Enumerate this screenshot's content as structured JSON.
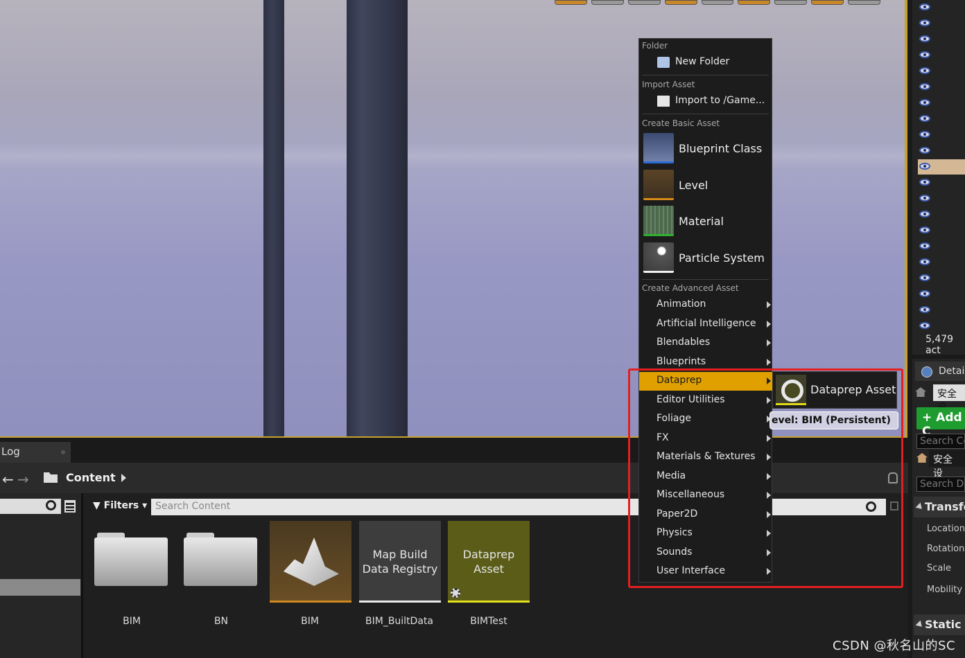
{
  "viewport": {
    "level_badge": "evel:  BIM (Persistent)"
  },
  "outliner": {
    "actor_count": "5,479 act"
  },
  "details": {
    "tab_label": "Detail",
    "cn_text_1": "安全设",
    "add_label": "Add C",
    "search_components_placeholder": "Search Co",
    "cn_text_2": "安全设",
    "search_details_placeholder": "Search De",
    "transform_header": "Transfo",
    "props": [
      "Location",
      "Rotation",
      "Scale",
      "Mobility"
    ],
    "static_header": "Static M"
  },
  "bottom": {
    "log_tab": "Log",
    "path": "Content",
    "filters_label": "Filters",
    "search_placeholder": "Search Content"
  },
  "assets": [
    {
      "label": "BIM",
      "kind": "folder"
    },
    {
      "label": "BN",
      "kind": "folder"
    },
    {
      "label": "BIM",
      "kind": "level"
    },
    {
      "label": "BIM_BuiltData",
      "kind": "map",
      "tile_text": "Map Build\nData Registry"
    },
    {
      "label": "BIMTest",
      "kind": "dataprep",
      "tile_text": "Dataprep\nAsset"
    }
  ],
  "menu": {
    "folder_header": "Folder",
    "new_folder": "New Folder",
    "import_header": "Import Asset",
    "import_to": "Import to /Game...",
    "basic_header": "Create Basic Asset",
    "basic_items": [
      {
        "label": "Blueprint Class",
        "accent": "#2a6ad8",
        "icon": "blueprint-class-icon"
      },
      {
        "label": "Level",
        "accent": "#d88a18",
        "icon": "level-icon"
      },
      {
        "label": "Material",
        "accent": "#30b030",
        "icon": "material-icon"
      },
      {
        "label": "Particle System",
        "accent": "#f0f0f0",
        "icon": "particle-system-icon"
      }
    ],
    "advanced_header": "Create Advanced Asset",
    "advanced_items": [
      "Animation",
      "Artificial Intelligence",
      "Blendables",
      "Blueprints",
      "Dataprep",
      "Editor Utilities",
      "Foliage",
      "FX",
      "Materials & Textures",
      "Media",
      "Miscellaneous",
      "Paper2D",
      "Physics",
      "Sounds",
      "User Interface"
    ],
    "active_item": "Dataprep"
  },
  "submenu": {
    "item_label": "Dataprep Asset"
  },
  "watermark": "CSDN @秋名山的SC"
}
